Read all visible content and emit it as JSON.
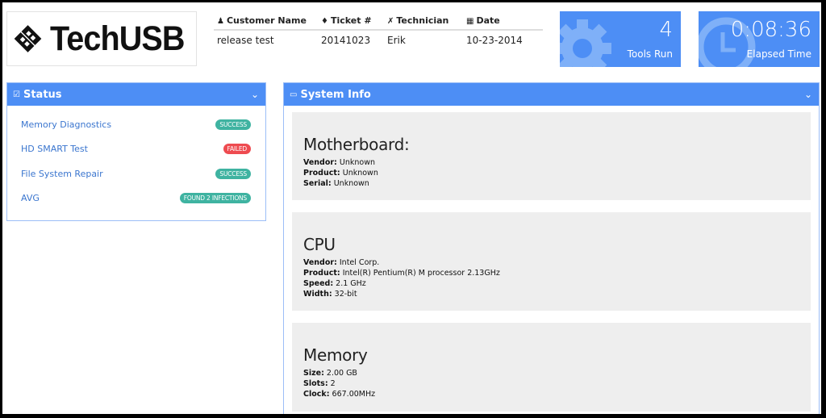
{
  "brand": {
    "name": "TechUSB"
  },
  "ticket": {
    "headers": [
      {
        "icon": "user-icon",
        "label": "Customer Name"
      },
      {
        "icon": "tag-icon",
        "label": "Ticket #"
      },
      {
        "icon": "wrench-icon",
        "label": "Technician"
      },
      {
        "icon": "calendar-icon",
        "label": "Date"
      }
    ],
    "values": [
      "release test",
      "20141023",
      "Erik",
      "10-23-2014"
    ]
  },
  "stats": {
    "tools_run": {
      "value": "4",
      "label": "Tools Run"
    },
    "elapsed": {
      "value": "0:08:36",
      "label": "Elapsed Time"
    },
    "color": "#4d8ef5"
  },
  "status_panel": {
    "title": "Status",
    "items": [
      {
        "label": "Memory Diagnostics",
        "badge": "SUCCESS",
        "state": "success"
      },
      {
        "label": "HD SMART Test",
        "badge": "FAILED",
        "state": "failed"
      },
      {
        "label": "File System Repair",
        "badge": "SUCCESS",
        "state": "success"
      },
      {
        "label": "AVG",
        "badge": "FOUND 2 INFECTIONS",
        "state": "success"
      }
    ]
  },
  "sysinfo_panel": {
    "title": "System Info",
    "sections": [
      {
        "title": "Motherboard:",
        "fields": [
          {
            "key": "Vendor:",
            "value": " Unknown"
          },
          {
            "key": "Product:",
            "value": " Unknown"
          },
          {
            "key": "Serial:",
            "value": " Unknown"
          }
        ]
      },
      {
        "title": "CPU",
        "fields": [
          {
            "key": "Vendor:",
            "value": " Intel Corp."
          },
          {
            "key": "Product:",
            "value": " Intel(R) Pentium(R) M processor 2.13GHz"
          },
          {
            "key": "Speed:",
            "value": " 2.1 GHz"
          },
          {
            "key": "Width:",
            "value": " 32-bit"
          }
        ]
      },
      {
        "title": "Memory",
        "fields": [
          {
            "key": "Size:",
            "value": " 2.00 GB"
          },
          {
            "key": "Slots:",
            "value": " 2"
          },
          {
            "key": "Clock:",
            "value": " 667.00MHz"
          }
        ]
      }
    ]
  },
  "colors": {
    "accent": "#4d8ef5",
    "success": "#3fb3a1",
    "failed": "#ee4b50",
    "link": "#3b76cf"
  }
}
